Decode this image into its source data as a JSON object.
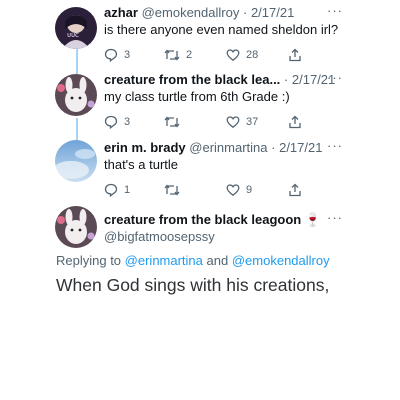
{
  "tweets": [
    {
      "name": "azhar",
      "handle": "@emokendallroy",
      "date": "2/17/21",
      "text": "is there anyone even named sheldon irl?",
      "replies": "3",
      "retweets": "2",
      "likes": "28"
    },
    {
      "name": "creature from the black lea...",
      "date": "2/17/21",
      "text": "my class turtle from 6th Grade :)",
      "replies": "3",
      "retweets": "",
      "likes": "37"
    },
    {
      "name": "erin m. brady",
      "handle": "@erinmartina",
      "date": "2/17/21",
      "text": "that's a turtle",
      "replies": "1",
      "retweets": "",
      "likes": "9"
    }
  ],
  "main_tweet": {
    "name": "creature from the black leagoon",
    "emoji": "🍷",
    "handle": "@bigfatmoosepssy",
    "replying_prefix": "Replying to",
    "replying_to_1": "@erinmartina",
    "replying_and": "and",
    "replying_to_2": "@emokendallroy",
    "text": "When God sings with his creations,"
  },
  "ui": {
    "dot": "·",
    "more": "···"
  },
  "colors": {
    "accent": "#1d9bf0",
    "thread_line": "#a6d2f5",
    "muted": "#536471"
  }
}
